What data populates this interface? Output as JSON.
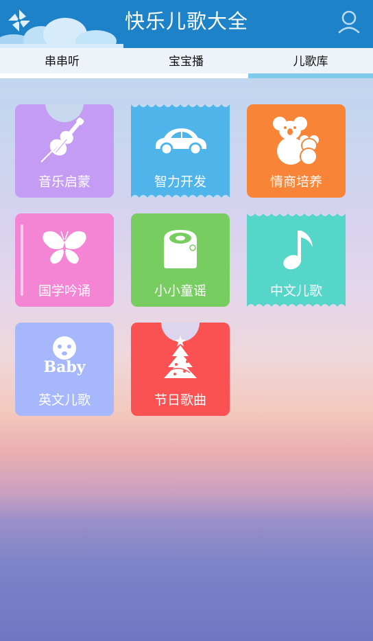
{
  "header": {
    "title": "快乐儿歌大全",
    "logo_icon": "pinwheel-icon",
    "user_icon": "user-icon",
    "color": "#1e82c8"
  },
  "tabs": [
    {
      "label": "串串听",
      "active": false
    },
    {
      "label": "宝宝播",
      "active": false
    },
    {
      "label": "儿歌库",
      "active": true
    }
  ],
  "categories": [
    {
      "label": "音乐启蒙",
      "icon": "violin-icon",
      "color": "#c49cf3"
    },
    {
      "label": "智力开发",
      "icon": "car-icon",
      "color": "#4fb4e9"
    },
    {
      "label": "情商培养",
      "icon": "koala-icon",
      "color": "#f88437"
    },
    {
      "label": "国学吟诵",
      "icon": "butterfly-icon",
      "color": "#f485d5"
    },
    {
      "label": "小小童谣",
      "icon": "toilet-roll-icon",
      "color": "#78cd60"
    },
    {
      "label": "中文儿歌",
      "icon": "music-note-icon",
      "color": "#56d5c9"
    },
    {
      "label": "英文儿歌",
      "icon": "baby-icon",
      "icon_text": "Baby",
      "color": "#a6b8fb"
    },
    {
      "label": "节日歌曲",
      "icon": "christmas-tree-icon",
      "color": "#fa5252"
    }
  ]
}
